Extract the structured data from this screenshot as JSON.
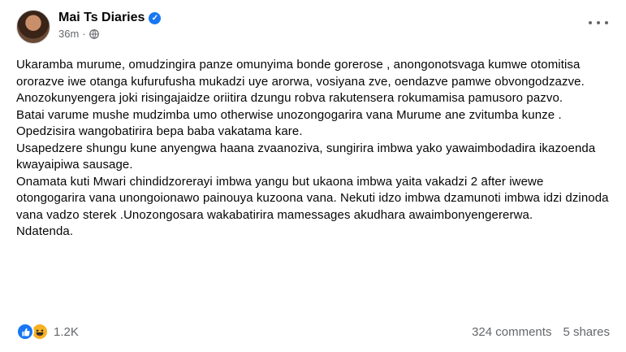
{
  "author": {
    "name": "Mai Ts Diaries",
    "time": "36m",
    "separator": "·"
  },
  "post": {
    "paragraphs": [
      "Ukaramba murume, omudzingira panze omunyima bonde gorerose , anongonotsvaga kumwe otomitisa ororazve iwe otanga kufurufusha mukadzi uye arorwa, vosiyana zve, oendazve pamwe obvongodzazve. Anozokunyengera joki risingajaidze oriitira dzungu robva rakutensera rokumamisa pamusoro pazvo.",
      "Batai varume mushe mudzimba umo otherwise unozongogarira vana Murume ane zvitumba kunze .",
      "Opedzisira wangobatirira bepa baba vakatama kare.",
      "Usapedzere shungu kune anyengwa haana zvaanoziva, sungirira imbwa yako yawaimbodadira ikazoenda kwayaipiwa sausage.",
      "Onamata kuti Mwari chindidzorerayi imbwa yangu but ukaona imbwa yaita vakadzi 2 after iwewe otongogarira vana unongoionawo painouya kuzoona vana. Nekuti idzo imbwa dzamunoti imbwa idzi dzinoda vana vadzo sterek .Unozongosara wakabatirira mamessages akudhara awaimbonyengererwa.",
      "Ndatenda."
    ]
  },
  "stats": {
    "reaction_count": "1.2K",
    "comments": "324 comments",
    "shares": "5 shares"
  },
  "icons": {
    "verified": "verified-badge-icon",
    "privacy": "globe-icon",
    "more": "more-options-icon",
    "like": "like-reaction-icon",
    "haha": "haha-reaction-icon"
  },
  "colors": {
    "brand_blue": "#1877f2",
    "secondary_text": "#65676b",
    "haha_yellow": "#f7b125"
  }
}
